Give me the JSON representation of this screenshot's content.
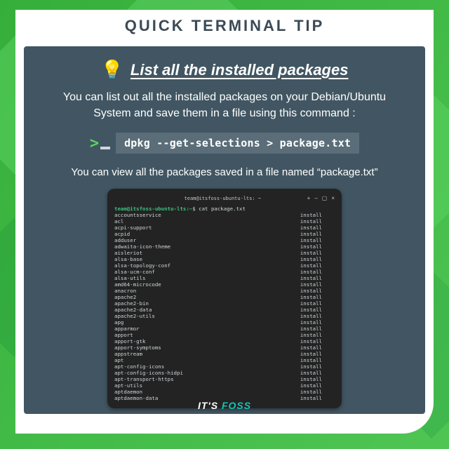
{
  "title": "QUICK TERMINAL TIP",
  "heading": "List all the installed packages",
  "description": "You can list out all the installed packages on your Debian/Ubuntu System and save them in a file using this command :",
  "command": "dpkg --get-selections > package.txt",
  "subtext": "You can view all the packages saved in a file named “package.txt”",
  "terminal": {
    "windowTitle": "team@itsfoss-ubuntu-lts: ~",
    "promptUser": "team@itsfoss-ubuntu-lts",
    "promptPath": ":~",
    "promptCmd": "$ cat package.txt",
    "packages": [
      "accountsservice",
      "acl",
      "acpi-support",
      "acpid",
      "adduser",
      "adwaita-icon-theme",
      "aisleriot",
      "alsa-base",
      "alsa-topology-conf",
      "alsa-ucm-conf",
      "alsa-utils",
      "amd64-microcode",
      "anacron",
      "apache2",
      "apache2-bin",
      "apache2-data",
      "apache2-utils",
      "apg",
      "apparmor",
      "apport",
      "apport-gtk",
      "apport-symptoms",
      "appstream",
      "apt",
      "apt-config-icons",
      "apt-config-icons-hidpi",
      "apt-transport-https",
      "apt-utils",
      "aptdaemon",
      "aptdaemon-data"
    ],
    "status": "install"
  },
  "brand": {
    "a": "IT'S ",
    "b": "FOSS"
  }
}
